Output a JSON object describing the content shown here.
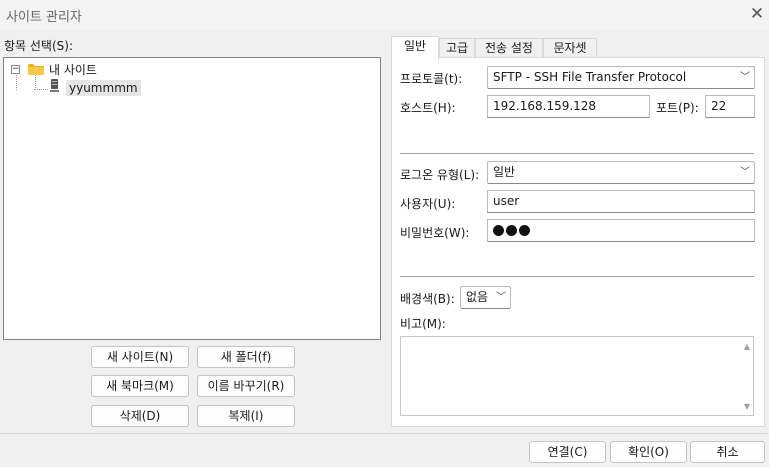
{
  "window": {
    "title": "사이트 관리자",
    "close_icon": "close-icon"
  },
  "tree": {
    "label": "항목 선택(S):",
    "root": {
      "expander": "⊟",
      "label": "내 사이트"
    },
    "items": [
      {
        "label": "yyummmm"
      }
    ]
  },
  "left_buttons": {
    "new_site": "새 사이트(N)",
    "new_folder": "새 폴더(f)",
    "new_bookmark": "새 북마크(M)",
    "rename": "이름 바꾸기(R)",
    "delete": "삭제(D)",
    "duplicate": "복제(I)"
  },
  "tabs": [
    "일반",
    "고급",
    "전송 설정",
    "문자셋"
  ],
  "general": {
    "protocol_label": "프로토콜(t):",
    "protocol_value": "SFTP - SSH File Transfer Protocol",
    "host_label": "호스트(H):",
    "host_value": "192.168.159.128",
    "port_label": "포트(P):",
    "port_value": "22",
    "logon_type_label": "로그온 유형(L):",
    "logon_type_value": "일반",
    "user_label": "사용자(U):",
    "user_value": "user",
    "password_label": "비밀번호(W):",
    "background_color_label": "배경색(B):",
    "background_color_value": "없음",
    "comments_label": "비고(M):"
  },
  "footer": {
    "connect": "연결(C)",
    "ok": "확인(O)",
    "cancel": "취소"
  },
  "colors": {
    "window_bg": "#f0f0f0",
    "folder": "#f0b429",
    "selected_bg": "#e5e5e5"
  }
}
